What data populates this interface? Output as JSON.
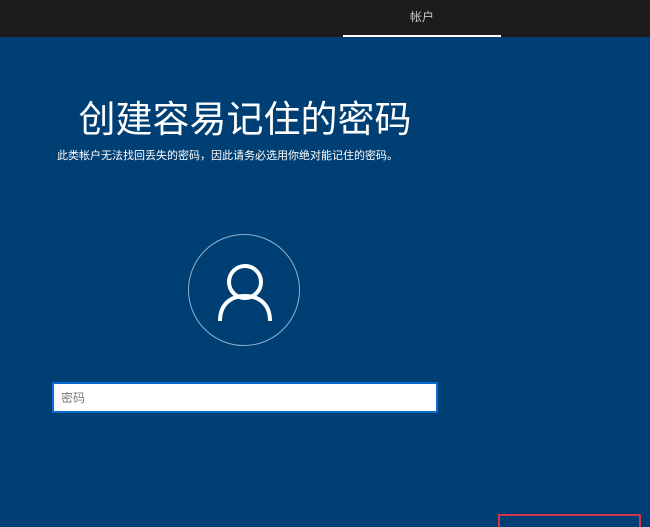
{
  "header": {
    "tab_label": "帐户"
  },
  "main": {
    "title": "创建容易记住的密码",
    "subtitle": "此类帐户无法找回丢失的密码，因此请务必选用你绝对能记住的密码。",
    "avatar_icon": "user-icon",
    "password_placeholder": "密码",
    "password_value": ""
  },
  "colors": {
    "background": "#003f73",
    "top_bar": "#1c1c1c",
    "input_border": "#0a6cd0",
    "highlight": "#d0334a"
  }
}
